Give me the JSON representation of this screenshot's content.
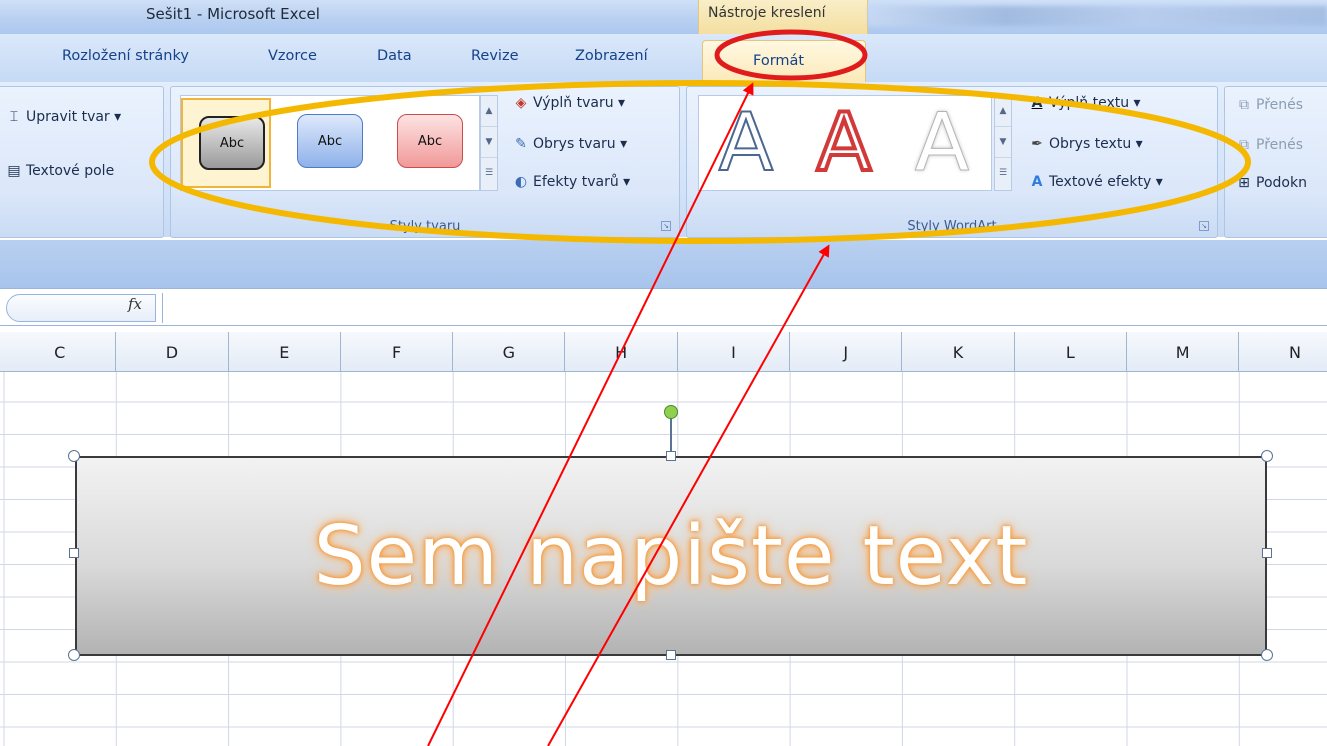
{
  "window": {
    "title": "Sešit1 - Microsoft Excel",
    "context_tab_header": "Nástroje kreslení"
  },
  "tabs": [
    {
      "label": "Rozložení stránky"
    },
    {
      "label": "Vzorce"
    },
    {
      "label": "Data"
    },
    {
      "label": "Revize"
    },
    {
      "label": "Zobrazení"
    },
    {
      "label": "Formát",
      "active": true
    }
  ],
  "ribbon": {
    "insert_group": {
      "edit_shape": "Upravit tvar ▾",
      "text_box": "Textové pole"
    },
    "shape_styles": {
      "label": "Styly tvaru",
      "thumb_text": "Abc",
      "shape_fill": "Výplň tvaru ▾",
      "shape_outline": "Obrys tvaru ▾",
      "shape_effects": "Efekty tvarů ▾"
    },
    "wordart_styles": {
      "label": "Styly WordArt",
      "glyph": "A",
      "text_fill": "Výplň textu ▾",
      "text_outline": "Obrys textu ▾",
      "text_effects": "Textové efekty ▾"
    },
    "arrange": {
      "bring_forward": "Přenés",
      "send_backward": "Přenés",
      "selection_pane": "Podokn"
    }
  },
  "formula_bar": {
    "fx_label": "fx"
  },
  "columns": [
    "C",
    "D",
    "E",
    "F",
    "G",
    "H",
    "I",
    "J",
    "K",
    "L",
    "M",
    "N"
  ],
  "shape": {
    "text": "Sem napište text"
  },
  "colors": {
    "highlight_ellipse_red": "#e01b1b",
    "highlight_ellipse_orange": "#f5b800",
    "arrow_red": "#ff0000"
  }
}
